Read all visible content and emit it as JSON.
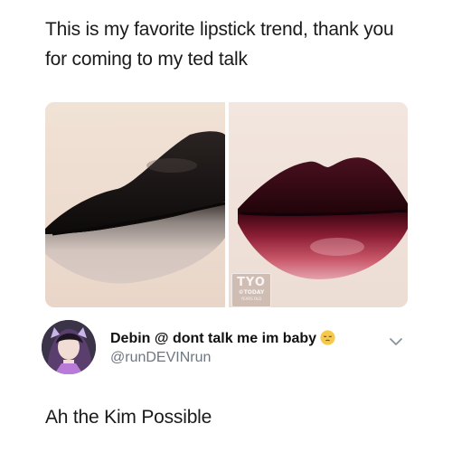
{
  "post": {
    "text": "This is my favorite lipstick trend, thank you for coming to my ted talk"
  },
  "photos": {
    "left": {
      "subject": "lips with black-to-nude ombre lipstick"
    },
    "right": {
      "subject": "lips with dark plum-to-red ombre lipstick"
    },
    "watermark": {
      "big": "TYO",
      "small": "©TODAY",
      "tiny": "YEARS OLD"
    }
  },
  "reply": {
    "display_name": "Debin @ dont talk me im baby",
    "emoji": "pensive-face-emoji",
    "handle": "@runDEVINrun",
    "body": "Ah the Kim Possible"
  },
  "icons": {
    "chevron": "chevron-down-icon"
  },
  "colors": {
    "text": "#1a1a1a",
    "handle": "#6e7680",
    "lip_black": "#1a1412",
    "lip_nude": "#d8c6bd",
    "lip_plum": "#3a0a16",
    "lip_red": "#c6495e"
  }
}
